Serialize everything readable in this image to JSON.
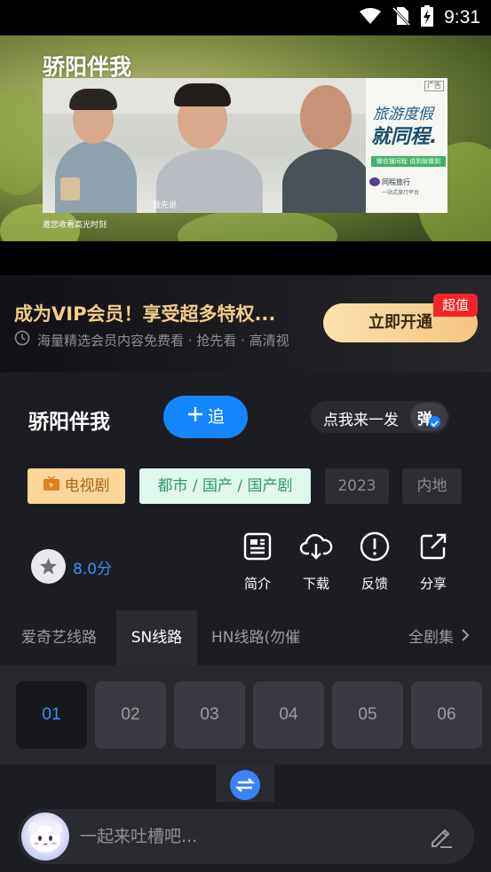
{
  "status_bar": {
    "time": "9:31"
  },
  "player": {
    "show_logo": "骄阳伴我",
    "caption": "邀您收看高光时刻",
    "subtitle": "我先说",
    "ad": {
      "tag": "广告",
      "slogan_line1": "旅游度假",
      "slogan_line2": "就同程.",
      "cta": "微信搜同程 说到就做到",
      "brand": "同程旅行",
      "brand_tagline": "一站式旅行平台"
    }
  },
  "vip_banner": {
    "title": "成为VIP会员！享受超多特权...",
    "subtitle": "海量精选会员内容免费看 · 抢先看 · 高清视",
    "button": "立即开通",
    "badge": "超值"
  },
  "details": {
    "title": "骄阳伴我",
    "follow_button": "追",
    "danmu_label": "点我来一发",
    "danmu_toggle_char": "弹",
    "tags": {
      "type": "电视剧",
      "genre": "都市 / 国产 / 国产剧",
      "year": "2023",
      "region": "内地"
    },
    "rating": "8.0分",
    "actions": [
      {
        "label": "简介",
        "icon": "document-icon"
      },
      {
        "label": "下载",
        "icon": "cloud-download-icon"
      },
      {
        "label": "反馈",
        "icon": "alert-circle-icon"
      },
      {
        "label": "分享",
        "icon": "share-icon"
      }
    ],
    "lines": [
      {
        "label": "爱奇艺线路",
        "active": false
      },
      {
        "label": "SN线路",
        "active": true
      },
      {
        "label": "HN线路(勿催",
        "active": false
      }
    ],
    "all_episodes": "全剧集"
  },
  "episodes": [
    {
      "label": "01",
      "active": true
    },
    {
      "label": "02",
      "active": false
    },
    {
      "label": "03",
      "active": false
    },
    {
      "label": "04",
      "active": false
    },
    {
      "label": "05",
      "active": false
    },
    {
      "label": "06",
      "active": false
    }
  ],
  "comment": {
    "placeholder": "一起来吐槽吧..."
  },
  "colors": {
    "accent": "#1686ff",
    "vip_gold": "#f3cd86",
    "rating_blue": "#3e8cf5",
    "badge_red": "#f12526"
  }
}
